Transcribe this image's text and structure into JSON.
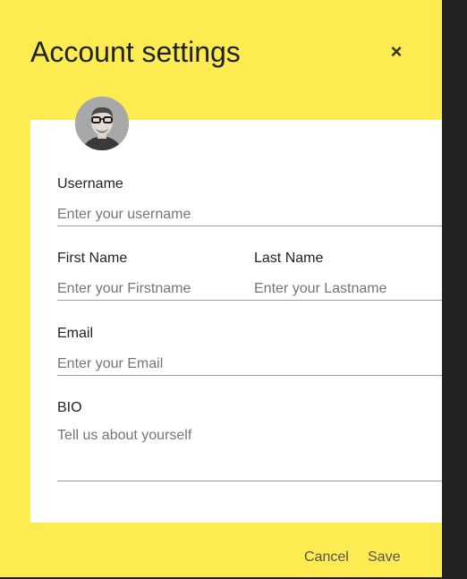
{
  "modal": {
    "title": "Account settings",
    "close_label": "×",
    "avatar_icon": "user-avatar-photo"
  },
  "form": {
    "username": {
      "label": "Username",
      "placeholder": "Enter your username"
    },
    "first_name": {
      "label": "First Name",
      "placeholder": "Enter your Firstname"
    },
    "last_name": {
      "label": "Last Name",
      "placeholder": "Enter your Lastname"
    },
    "email": {
      "label": "Email",
      "placeholder": "Enter your Email"
    },
    "bio": {
      "label": "BIO",
      "placeholder": "Tell us about yourself"
    }
  },
  "actions": {
    "cancel_label": "Cancel",
    "save_label": "Save"
  },
  "colors": {
    "modal_background": "#fdeb52",
    "card_background": "#ffffff",
    "backdrop": "#222222"
  }
}
